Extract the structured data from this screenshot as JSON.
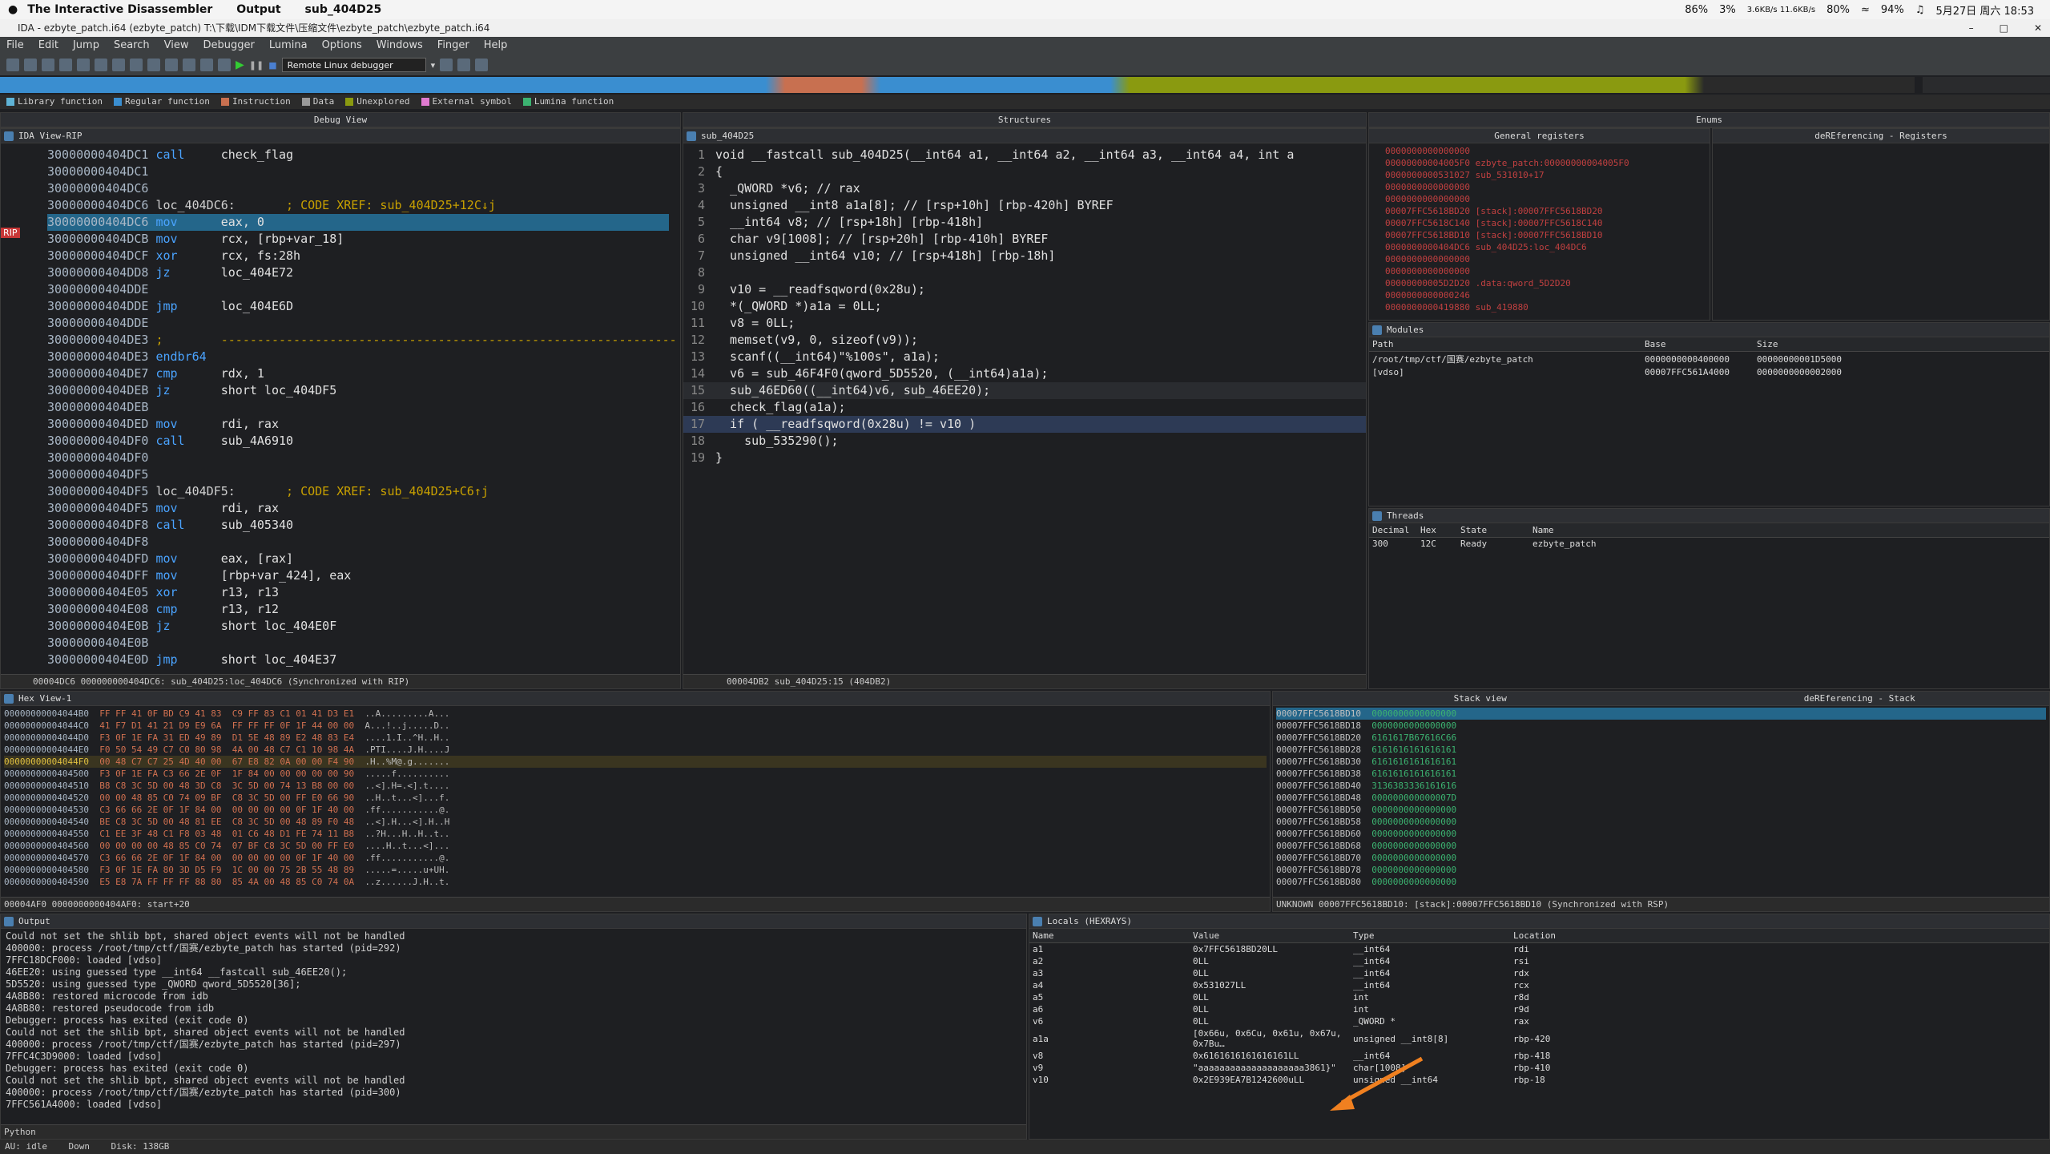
{
  "macbar": {
    "app": "The Interactive Disassembler",
    "menu": [
      "Output",
      "sub_404D25"
    ],
    "battery": "86%",
    "cpu": "3%",
    "net": "3.6KB/s 11.6KB/s",
    "mem": "80%",
    "volume": "94%",
    "clock": "5月27日 周六 18:53"
  },
  "window": {
    "title": "IDA - ezbyte_patch.i64 (ezbyte_patch) T:\\下载\\IDM下载文件\\压缩文件\\ezbyte_patch\\ezbyte_patch.i64"
  },
  "menu": [
    "File",
    "Edit",
    "Jump",
    "Search",
    "View",
    "Debugger",
    "Lumina",
    "Options",
    "Windows",
    "Finger",
    "Help"
  ],
  "toolbar": {
    "debugger": "Remote Linux debugger"
  },
  "legend": [
    {
      "label": "Library function",
      "color": "#5fb3d6"
    },
    {
      "label": "Regular function",
      "color": "#3a8ed0"
    },
    {
      "label": "Instruction",
      "color": "#c87050"
    },
    {
      "label": "Data",
      "color": "#9a9a9a"
    },
    {
      "label": "Unexplored",
      "color": "#8a9a10"
    },
    {
      "label": "External symbol",
      "color": "#e07ad0"
    },
    {
      "label": "Lumina function",
      "color": "#3cb371"
    }
  ],
  "panels": {
    "debug_view": "Debug View",
    "ida_view": "IDA View-RIP",
    "structures": "Structures",
    "pseudocode": "sub_404D25",
    "enums": "Enums",
    "gen_regs": "General registers",
    "deref_regs": "deREferencing - Registers",
    "modules": "Modules",
    "threads": "Threads",
    "hex": "Hex View-1",
    "stack": "Stack view",
    "deref_stack": "deREferencing - Stack",
    "output": "Output",
    "locals": "Locals (HEXRAYS)"
  },
  "disasm": [
    {
      "a": "30000000404DC1",
      "m": "call",
      "o": "check_flag",
      "c": ""
    },
    {
      "a": "30000000404DC1",
      "m": "",
      "o": "",
      "c": ""
    },
    {
      "a": "30000000404DC6",
      "m": "",
      "o": "",
      "c": ""
    },
    {
      "a": "30000000404DC6",
      "m": "loc_404DC6:",
      "o": "",
      "c": "; CODE XREF: sub_404D25+12C↓j"
    },
    {
      "a": "30000000404DC6",
      "m": "mov",
      "o": "eax, 0",
      "c": "",
      "hl": true
    },
    {
      "a": "30000000404DCB",
      "m": "mov",
      "o": "rcx, [rbp+var_18]",
      "c": ""
    },
    {
      "a": "30000000404DCF",
      "m": "xor",
      "o": "rcx, fs:28h",
      "c": ""
    },
    {
      "a": "30000000404DD8",
      "m": "jz",
      "o": "loc_404E72",
      "c": ""
    },
    {
      "a": "30000000404DDE",
      "m": "",
      "o": "",
      "c": ""
    },
    {
      "a": "30000000404DDE",
      "m": "jmp",
      "o": "loc_404E6D",
      "c": ""
    },
    {
      "a": "30000000404DDE",
      "m": "",
      "o": "",
      "c": ""
    },
    {
      "a": "30000000404DE3",
      "m": ";",
      "o": "---------------------------------------------------------------",
      "c": ""
    },
    {
      "a": "30000000404DE3",
      "m": "endbr64",
      "o": "",
      "c": ""
    },
    {
      "a": "30000000404DE7",
      "m": "cmp",
      "o": "rdx, 1",
      "c": ""
    },
    {
      "a": "30000000404DEB",
      "m": "jz",
      "o": "short loc_404DF5",
      "c": ""
    },
    {
      "a": "30000000404DEB",
      "m": "",
      "o": "",
      "c": ""
    },
    {
      "a": "30000000404DED",
      "m": "mov",
      "o": "rdi, rax",
      "c": ""
    },
    {
      "a": "30000000404DF0",
      "m": "call",
      "o": "sub_4A6910",
      "c": ""
    },
    {
      "a": "30000000404DF0",
      "m": "",
      "o": "",
      "c": ""
    },
    {
      "a": "30000000404DF5",
      "m": "",
      "o": "",
      "c": ""
    },
    {
      "a": "30000000404DF5",
      "m": "loc_404DF5:",
      "o": "",
      "c": "; CODE XREF: sub_404D25+C6↑j"
    },
    {
      "a": "30000000404DF5",
      "m": "mov",
      "o": "rdi, rax",
      "c": ""
    },
    {
      "a": "30000000404DF8",
      "m": "call",
      "o": "sub_405340",
      "c": ""
    },
    {
      "a": "30000000404DF8",
      "m": "",
      "o": "",
      "c": ""
    },
    {
      "a": "30000000404DFD",
      "m": "mov",
      "o": "eax, [rax]",
      "c": ""
    },
    {
      "a": "30000000404DFF",
      "m": "mov",
      "o": "[rbp+var_424], eax",
      "c": ""
    },
    {
      "a": "30000000404E05",
      "m": "xor",
      "o": "r13, r13",
      "c": ""
    },
    {
      "a": "30000000404E08",
      "m": "cmp",
      "o": "r13, r12",
      "c": ""
    },
    {
      "a": "30000000404E0B",
      "m": "jz",
      "o": "short loc_404E0F",
      "c": ""
    },
    {
      "a": "30000000404E0B",
      "m": "",
      "o": "",
      "c": ""
    },
    {
      "a": "30000000404E0D",
      "m": "jmp",
      "o": "short loc_404E37",
      "c": ""
    }
  ],
  "disasm_status": "00004DC6 000000000404DC6: sub_404D25:loc_404DC6 (Synchronized with RIP)",
  "pseudo": [
    "void __fastcall sub_404D25(__int64 a1, __int64 a2, __int64 a3, __int64 a4, int a",
    "{",
    "  _QWORD *v6; // rax",
    "  unsigned __int8 a1a[8]; // [rsp+10h] [rbp-420h] BYREF",
    "  __int64 v8; // [rsp+18h] [rbp-418h]",
    "  char v9[1008]; // [rsp+20h] [rbp-410h] BYREF",
    "  unsigned __int64 v10; // [rsp+418h] [rbp-18h]",
    "",
    "  v10 = __readfsqword(0x28u);",
    "  *(_QWORD *)a1a = 0LL;",
    "  v8 = 0LL;",
    "  memset(v9, 0, sizeof(v9));",
    "  scanf((__int64)\"%100s\", a1a);",
    "  v6 = sub_46F4F0(qword_5D5520, (__int64)a1a);",
    "  sub_46ED60((__int64)v6, sub_46EE20);",
    "  check_flag(a1a);",
    "  if ( __readfsqword(0x28u) != v10 )",
    "    sub_535290();",
    "}"
  ],
  "pseudo_status": "00004DB2 sub_404D25:15 (404DB2)",
  "regs": [
    "0000000000000000",
    "00000000004005F0 ezbyte_patch:00000000004005F0",
    "0000000000531027 sub_531010+17",
    "0000000000000000",
    "0000000000000000",
    "00007FFC5618BD20 [stack]:00007FFC5618BD20",
    "00007FFC5618C140 [stack]:00007FFC5618C140",
    "00007FFC5618BD10 [stack]:00007FFC5618BD10",
    "0000000000404DC6 sub_404D25:loc_404DC6",
    "0000000000000000",
    "0000000000000000",
    "00000000005D2D20 .data:qword_5D2D20",
    "0000000000000246",
    "0000000000419880 sub_419880"
  ],
  "modules": {
    "cols": [
      "Path",
      "Base",
      "Size"
    ],
    "rows": [
      [
        "/root/tmp/ctf/国赛/ezbyte_patch",
        "0000000000400000",
        "00000000001D5000"
      ],
      [
        "[vdso]",
        "00007FFC561A4000",
        "0000000000002000"
      ]
    ]
  },
  "threads": {
    "cols": [
      "Decimal",
      "Hex",
      "State",
      "Name"
    ],
    "rows": [
      [
        "300",
        "12C",
        "Ready",
        "ezbyte_patch"
      ]
    ]
  },
  "hex": [
    [
      "00000000004044B0",
      "FF FF 41 0F BD C9 41 83  C9 FF 83 C1 01 41 D3 E1",
      "..A.........A..."
    ],
    [
      "00000000004044C0",
      "41 F7 D1 41 21 D9 E9 6A  FF FF FF 0F 1F 44 00 00",
      "A...!..j.....D.."
    ],
    [
      "00000000004044D0",
      "F3 0F 1E FA 31 ED 49 89  D1 5E 48 89 E2 48 83 E4",
      "....1.I..^H..H.."
    ],
    [
      "00000000004044E0",
      "F0 50 54 49 C7 C0 80 98  4A 00 48 C7 C1 10 98 4A",
      ".PTI....J.H....J"
    ],
    [
      "00000000004044F0",
      "00 48 C7 C7 25 4D 40 00  67 E8 82 0A 00 00 F4 90",
      ".H..%M@.g......."
    ],
    [
      "0000000000404500",
      "F3 0F 1E FA C3 66 2E 0F  1F 84 00 00 00 00 00 90",
      ".....f.........."
    ],
    [
      "0000000000404510",
      "B8 C8 3C 5D 00 48 3D C8  3C 5D 00 74 13 B8 00 00",
      "..<].H=.<].t...."
    ],
    [
      "0000000000404520",
      "00 00 48 85 C0 74 09 BF  C8 3C 5D 00 FF E0 66 90",
      "..H..t...<]...f."
    ],
    [
      "0000000000404530",
      "C3 66 66 2E 0F 1F 84 00  00 00 00 00 0F 1F 40 00",
      ".ff...........@."
    ],
    [
      "0000000000404540",
      "BE C8 3C 5D 00 48 81 EE  C8 3C 5D 00 48 89 F0 48",
      "..<].H...<].H..H"
    ],
    [
      "0000000000404550",
      "C1 EE 3F 48 C1 F8 03 48  01 C6 48 D1 FE 74 11 B8",
      "..?H...H..H..t.."
    ],
    [
      "0000000000404560",
      "00 00 00 00 48 85 C0 74  07 BF C8 3C 5D 00 FF E0",
      "....H..t...<]..."
    ],
    [
      "0000000000404570",
      "C3 66 66 2E 0F 1F 84 00  00 00 00 00 0F 1F 40 00",
      ".ff...........@."
    ],
    [
      "0000000000404580",
      "F3 0F 1E FA 80 3D D5 F9  1C 00 00 75 2B 55 48 89",
      ".....=.....u+UH."
    ],
    [
      "0000000000404590",
      "E5 E8 7A FF FF FF 88 80  85 4A 00 48 85 C0 74 0A",
      "..z......J.H..t."
    ]
  ],
  "hex_status": "00004AF0 0000000000404AF0: start+20",
  "stack": [
    [
      "00007FFC5618BD10",
      "0000000000000000"
    ],
    [
      "00007FFC5618BD18",
      "0000000000000000"
    ],
    [
      "00007FFC5618BD20",
      "6161617B67616C66"
    ],
    [
      "00007FFC5618BD28",
      "6161616161616161"
    ],
    [
      "00007FFC5618BD30",
      "6161616161616161"
    ],
    [
      "00007FFC5618BD38",
      "6161616161616161"
    ],
    [
      "00007FFC5618BD40",
      "3136383336161616"
    ],
    [
      "00007FFC5618BD48",
      "000000000000007D"
    ],
    [
      "00007FFC5618BD50",
      "0000000000000000"
    ],
    [
      "00007FFC5618BD58",
      "0000000000000000"
    ],
    [
      "00007FFC5618BD60",
      "0000000000000000"
    ],
    [
      "00007FFC5618BD68",
      "0000000000000000"
    ],
    [
      "00007FFC5618BD70",
      "0000000000000000"
    ],
    [
      "00007FFC5618BD78",
      "0000000000000000"
    ],
    [
      "00007FFC5618BD80",
      "0000000000000000"
    ]
  ],
  "stack_status": "UNKNOWN 00007FFC5618BD10: [stack]:00007FFC5618BD10 (Synchronized with RSP)",
  "output_lines": [
    "Could not set the shlib bpt, shared object events will not be handled",
    "400000: process /root/tmp/ctf/国赛/ezbyte_patch has started (pid=292)",
    "7FFC18DCF000: loaded [vdso]",
    "46EE20: using guessed type __int64 __fastcall sub_46EE20();",
    "5D5520: using guessed type _QWORD qword_5D5520[36];",
    "4A8B80: restored microcode from idb",
    "4A8B80: restored pseudocode from idb",
    "Debugger: process has exited (exit code 0)",
    "Could not set the shlib bpt, shared object events will not be handled",
    "400000: process /root/tmp/ctf/国赛/ezbyte_patch has started (pid=297)",
    "7FFC4C3D9000: loaded [vdso]",
    "Debugger: process has exited (exit code 0)",
    "Could not set the shlib bpt, shared object events will not be handled",
    "400000: process /root/tmp/ctf/国赛/ezbyte_patch has started (pid=300)",
    "7FFC561A4000: loaded [vdso]"
  ],
  "output_lang": "Python",
  "locals": {
    "cols": [
      "Name",
      "Value",
      "Type",
      "Location"
    ],
    "rows": [
      [
        "a1",
        "0x7FFC5618BD20LL",
        "__int64",
        "rdi"
      ],
      [
        "a2",
        "0LL",
        "__int64",
        "rsi"
      ],
      [
        "a3",
        "0LL",
        "__int64",
        "rdx"
      ],
      [
        "a4",
        "0x531027LL",
        "__int64",
        "rcx"
      ],
      [
        "a5",
        "0LL",
        "int",
        "r8d"
      ],
      [
        "a6",
        "0LL",
        "int",
        "r9d"
      ],
      [
        "v6",
        "0LL",
        "_QWORD *",
        "rax"
      ],
      [
        "a1a",
        "[0x66u, 0x6Cu, 0x61u, 0x67u, 0x7Bu…",
        "unsigned __int8[8]",
        "rbp-420"
      ],
      [
        "v8",
        "0x6161616161616161LL",
        "__int64",
        "rbp-418"
      ],
      [
        "v9",
        "\"aaaaaaaaaaaaaaaaaaaa3861}\"",
        "char[1008]",
        "rbp-410"
      ],
      [
        "v10",
        "0x2E939EA7B1242600uLL",
        "unsigned __int64",
        "rbp-18"
      ]
    ]
  },
  "bottom": {
    "au": "AU:",
    "state": "idle",
    "dir": "Down",
    "disk": "Disk: 138GB"
  }
}
